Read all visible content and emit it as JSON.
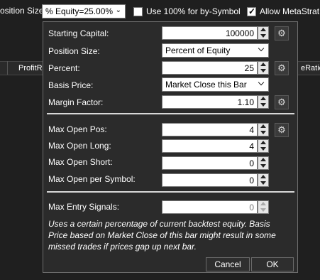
{
  "toolbar": {
    "position_size_label": "osition Size",
    "position_size_value": "% Equity=25.00%",
    "use_100_label": "Use 100% for by-Symbol",
    "use_100_checked": false,
    "allow_meta_label": "Allow MetaStrat",
    "allow_meta_checked": true
  },
  "background": {
    "col_profit": "ProfitR",
    "col_ratio": "eRatio"
  },
  "dialog": {
    "starting_capital": {
      "label": "Starting Capital:",
      "value": "100000"
    },
    "position_size": {
      "label": "Position Size:",
      "value": "Percent of Equity"
    },
    "percent": {
      "label": "Percent:",
      "value": "25"
    },
    "basis_price": {
      "label": "Basis Price:",
      "value": "Market Close this Bar"
    },
    "margin_factor": {
      "label": "Margin Factor:",
      "value": "1.10"
    },
    "max_open_pos": {
      "label": "Max Open Pos:",
      "value": "4"
    },
    "max_open_long": {
      "label": "Max Open Long:",
      "value": "4"
    },
    "max_open_short": {
      "label": "Max Open Short:",
      "value": "0"
    },
    "max_open_per_symbol": {
      "label": "Max Open per Symbol:",
      "value": "0"
    },
    "max_entry_signals": {
      "label": "Max Entry Signals:",
      "value": "0"
    },
    "description": "Uses a certain percentage of current backtest equity. Basis Price based on Market Close of this bar might result in some missed trades if prices gap up next bar.",
    "cancel_label": "Cancel",
    "ok_label": "OK"
  }
}
